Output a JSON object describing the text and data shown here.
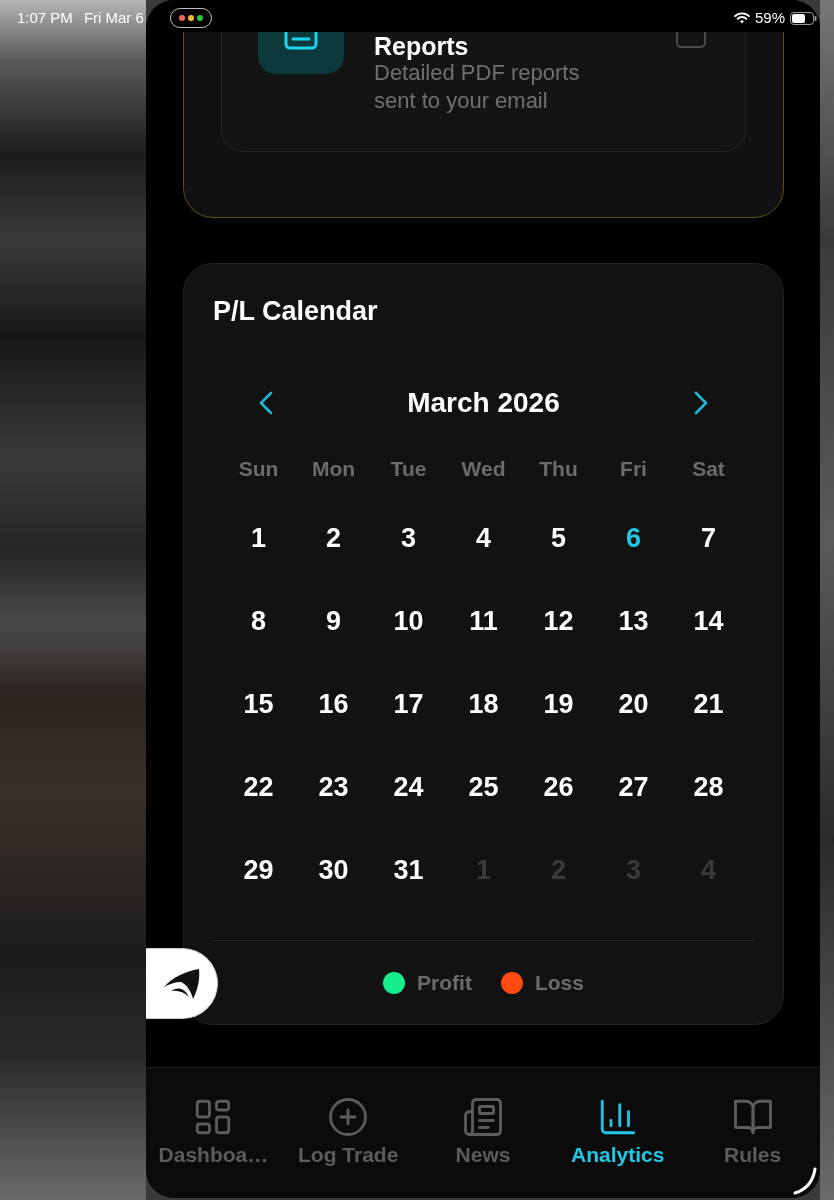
{
  "status_bar": {
    "time": "1:07 PM",
    "date": "Fri Mar 6",
    "battery": "59%"
  },
  "report_option": {
    "title": "Reports",
    "description": "Detailed PDF reports sent to your email",
    "checked": false
  },
  "calendar": {
    "title": "P/L Calendar",
    "month": "March 2026",
    "weekdays": [
      "Sun",
      "Mon",
      "Tue",
      "Wed",
      "Thu",
      "Fri",
      "Sat"
    ],
    "days": [
      {
        "label": "1",
        "in_month": true,
        "today": false
      },
      {
        "label": "2",
        "in_month": true,
        "today": false
      },
      {
        "label": "3",
        "in_month": true,
        "today": false
      },
      {
        "label": "4",
        "in_month": true,
        "today": false
      },
      {
        "label": "5",
        "in_month": true,
        "today": false
      },
      {
        "label": "6",
        "in_month": true,
        "today": true
      },
      {
        "label": "7",
        "in_month": true,
        "today": false
      },
      {
        "label": "8",
        "in_month": true,
        "today": false
      },
      {
        "label": "9",
        "in_month": true,
        "today": false
      },
      {
        "label": "10",
        "in_month": true,
        "today": false
      },
      {
        "label": "11",
        "in_month": true,
        "today": false
      },
      {
        "label": "12",
        "in_month": true,
        "today": false
      },
      {
        "label": "13",
        "in_month": true,
        "today": false
      },
      {
        "label": "14",
        "in_month": true,
        "today": false
      },
      {
        "label": "15",
        "in_month": true,
        "today": false
      },
      {
        "label": "16",
        "in_month": true,
        "today": false
      },
      {
        "label": "17",
        "in_month": true,
        "today": false
      },
      {
        "label": "18",
        "in_month": true,
        "today": false
      },
      {
        "label": "19",
        "in_month": true,
        "today": false
      },
      {
        "label": "20",
        "in_month": true,
        "today": false
      },
      {
        "label": "21",
        "in_month": true,
        "today": false
      },
      {
        "label": "22",
        "in_month": true,
        "today": false
      },
      {
        "label": "23",
        "in_month": true,
        "today": false
      },
      {
        "label": "24",
        "in_month": true,
        "today": false
      },
      {
        "label": "25",
        "in_month": true,
        "today": false
      },
      {
        "label": "26",
        "in_month": true,
        "today": false
      },
      {
        "label": "27",
        "in_month": true,
        "today": false
      },
      {
        "label": "28",
        "in_month": true,
        "today": false
      },
      {
        "label": "29",
        "in_month": true,
        "today": false
      },
      {
        "label": "30",
        "in_month": true,
        "today": false
      },
      {
        "label": "31",
        "in_month": true,
        "today": false
      },
      {
        "label": "1",
        "in_month": false,
        "today": false
      },
      {
        "label": "2",
        "in_month": false,
        "today": false
      },
      {
        "label": "3",
        "in_month": false,
        "today": false
      },
      {
        "label": "4",
        "in_month": false,
        "today": false
      }
    ],
    "legend": [
      {
        "label": "Profit",
        "color": "#16ee8c"
      },
      {
        "label": "Loss",
        "color": "#ff4b12"
      }
    ]
  },
  "tab_bar": {
    "tabs": [
      {
        "label": "Dashboa…",
        "selected": false
      },
      {
        "label": "Log Trade",
        "selected": false
      },
      {
        "label": "News",
        "selected": false
      },
      {
        "label": "Analytics",
        "selected": true
      },
      {
        "label": "Rules",
        "selected": false
      }
    ]
  }
}
